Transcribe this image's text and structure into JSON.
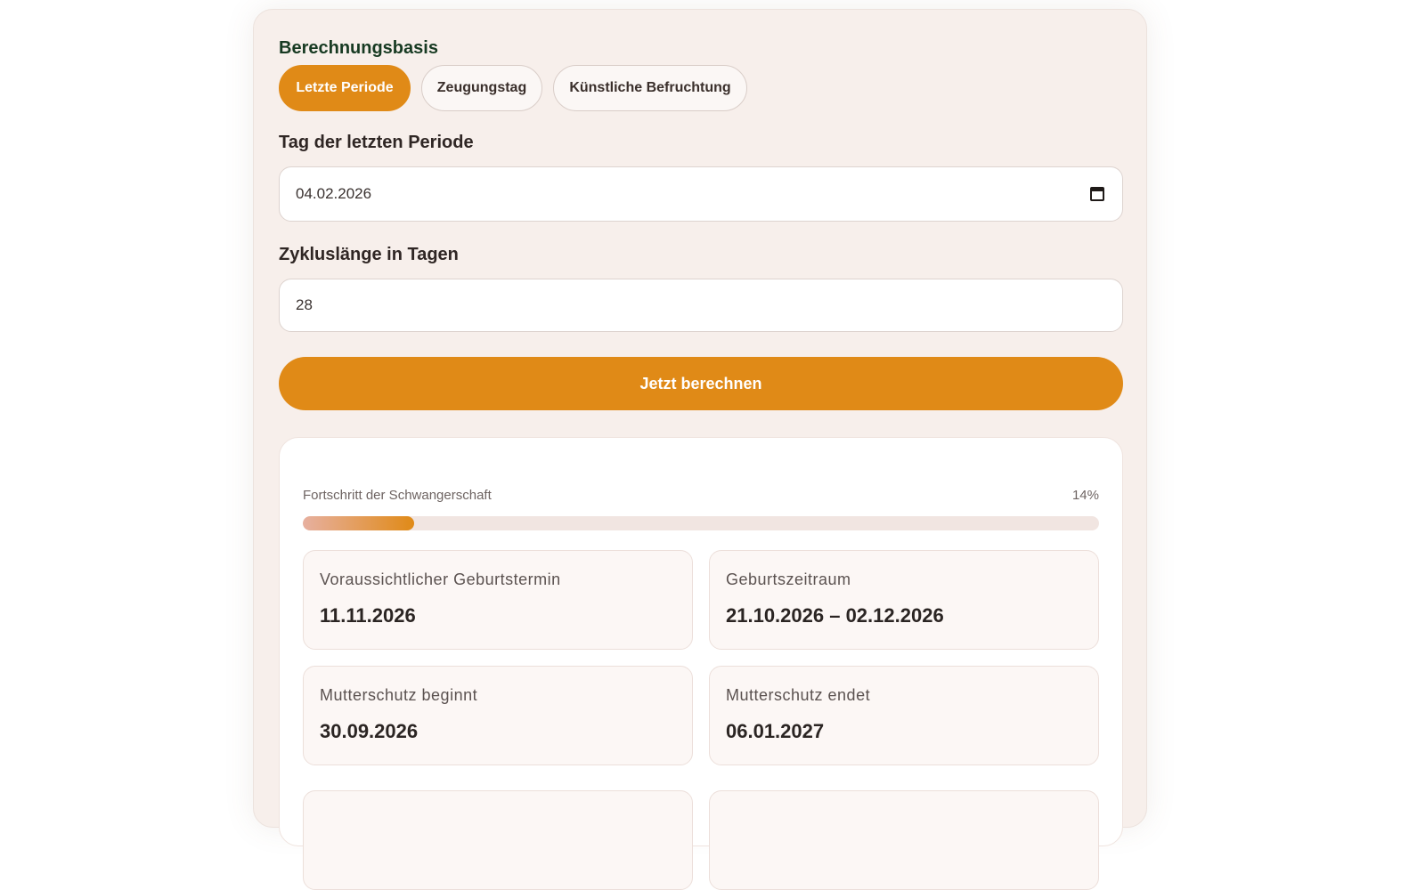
{
  "form": {
    "basis_title": "Berechnungsbasis",
    "basis_options": [
      "Letzte Periode",
      "Zeugungstag",
      "Künstliche Befruchtung"
    ],
    "selected_basis": "Letzte Periode",
    "last_period_label": "Tag der letzten Periode",
    "last_period_value": "04.02.2026",
    "cycle_length_label": "Zykluslänge in Tagen",
    "cycle_length_value": "28",
    "submit_label": "Jetzt berechnen"
  },
  "results": {
    "progress_label": "Fortschritt der Schwangerschaft",
    "progress_text": "14%",
    "progress_fraction": 0.14,
    "tiles": [
      {
        "label": "Voraussichtlicher Geburtstermin",
        "value": "11.11.2026"
      },
      {
        "label": "Geburtszeitraum",
        "value": "21.10.2026 – 02.12.2026"
      },
      {
        "label": "Mutterschutz beginnt",
        "value": "30.09.2026"
      },
      {
        "label": "Mutterschutz endet",
        "value": "06.01.2027"
      }
    ]
  },
  "colors": {
    "accent": "#e08a17",
    "card_background": "#f7efeb",
    "heading_green": "#173a22"
  },
  "icons": {
    "date_picker": "calendar-icon"
  }
}
